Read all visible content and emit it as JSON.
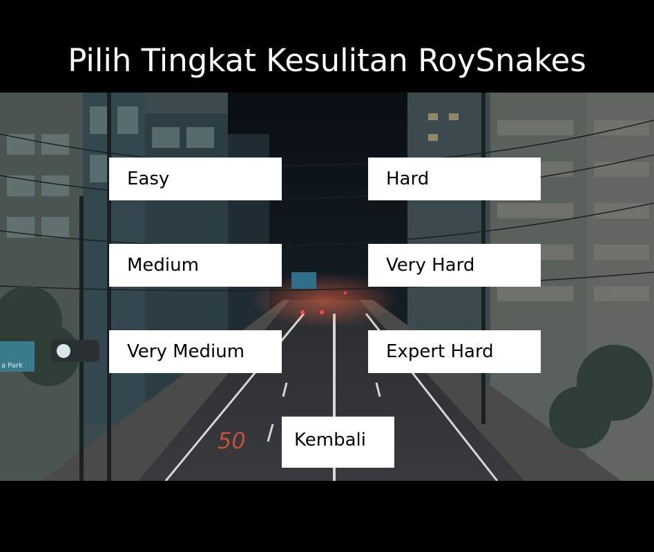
{
  "title": "Pilih Tingkat Kesulitan RoySnakes",
  "buttons": {
    "easy": "Easy",
    "medium": "Medium",
    "very_medium": "Very Medium",
    "hard": "Hard",
    "very_hard": "Very Hard",
    "expert_hard": "Expert Hard",
    "back": "Kembali"
  },
  "background": {
    "scene": "night-city-street",
    "road_marking": "50",
    "sign_text": "a Park"
  },
  "colors": {
    "bar": "#000000",
    "button_bg": "#ffffff",
    "button_text": "#000000",
    "title_text": "#ffffff"
  }
}
